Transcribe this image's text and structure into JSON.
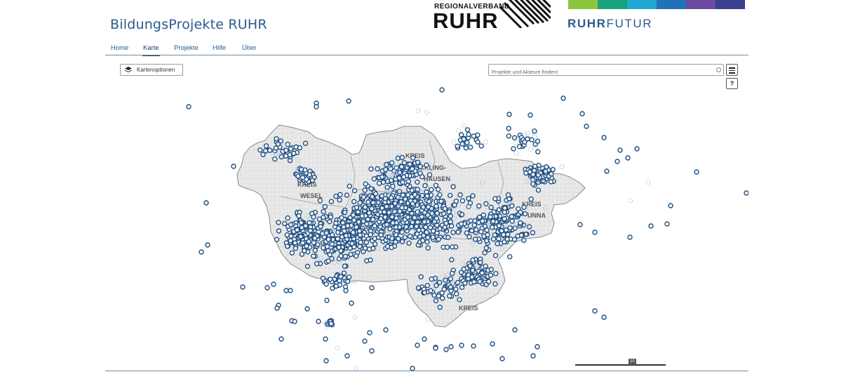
{
  "header": {
    "site_title": "BildungsProjekte RUHR",
    "rvr_small": "REGIONALVERBAND",
    "rvr_big": "RUHR",
    "ruhrfutur_bold": "RUHR",
    "ruhrfutur_rest": "FUTUR",
    "color_bar": [
      "#8cc63f",
      "#1aa37a",
      "#1fa9d4",
      "#1f72b8",
      "#6a4a9e",
      "#3a3f8f"
    ]
  },
  "nav": {
    "items": [
      {
        "label": "Home"
      },
      {
        "label": "Karte",
        "active": true
      },
      {
        "label": "Projekte"
      },
      {
        "label": "Hilfe"
      },
      {
        "label": "Über"
      }
    ]
  },
  "map": {
    "options_label": "Kartenoptionen",
    "search_placeholder": "Projekte und Akteure finden!",
    "help_label": "?",
    "scale_label": "10",
    "region_labels": [
      "KREIS",
      "RECKLING-",
      "HAUSEN",
      "KREIS",
      "WESEL",
      "KREIS",
      "UNNA",
      "KREIS"
    ],
    "marker_color": "#1f4f82"
  }
}
